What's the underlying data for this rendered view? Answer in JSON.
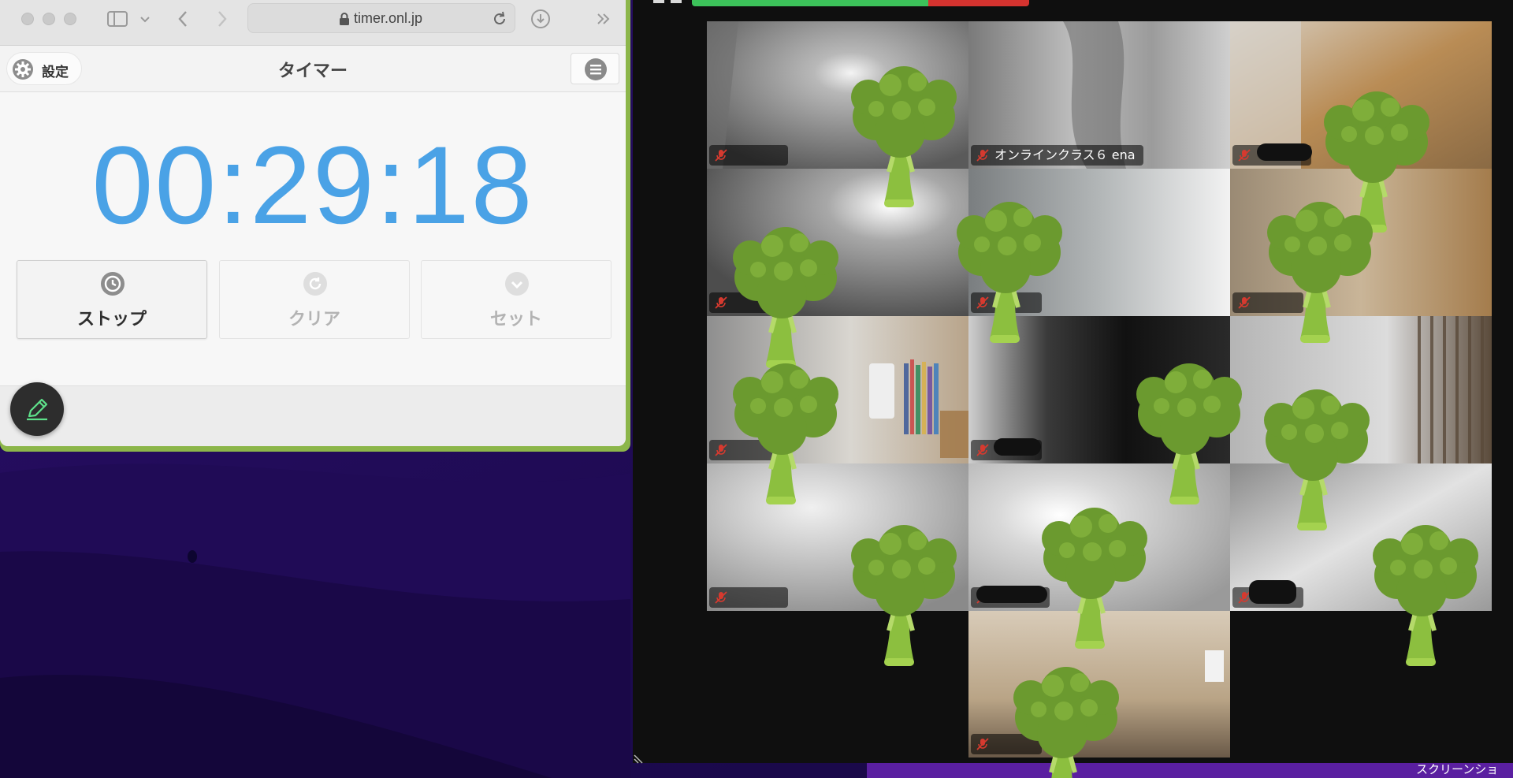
{
  "browser": {
    "address": "timer.onl.jp",
    "settings_label": "設定",
    "page_title": "タイマー"
  },
  "timer": {
    "display": "00:29:18",
    "buttons": [
      {
        "label": "ストップ",
        "state": "active",
        "icon": "clock-icon"
      },
      {
        "label": "クリア",
        "state": "disabled",
        "icon": "clear-icon"
      },
      {
        "label": "セット",
        "state": "disabled",
        "icon": "check-icon"
      }
    ],
    "colors": {
      "digits": "#4aa2e6",
      "active_label": "#2e2e2e",
      "disabled_label": "#b3b3b3",
      "frame": "#8cb64a"
    }
  },
  "meeting": {
    "named_participant": "オンラインクラス６ ena",
    "tiles": 13,
    "colors": {
      "mute": "#d63a2f",
      "bar_green": "#3cc25a",
      "bar_red": "#d4332f"
    }
  },
  "desktop": {
    "screenshot_label": "スクリーンショ"
  }
}
